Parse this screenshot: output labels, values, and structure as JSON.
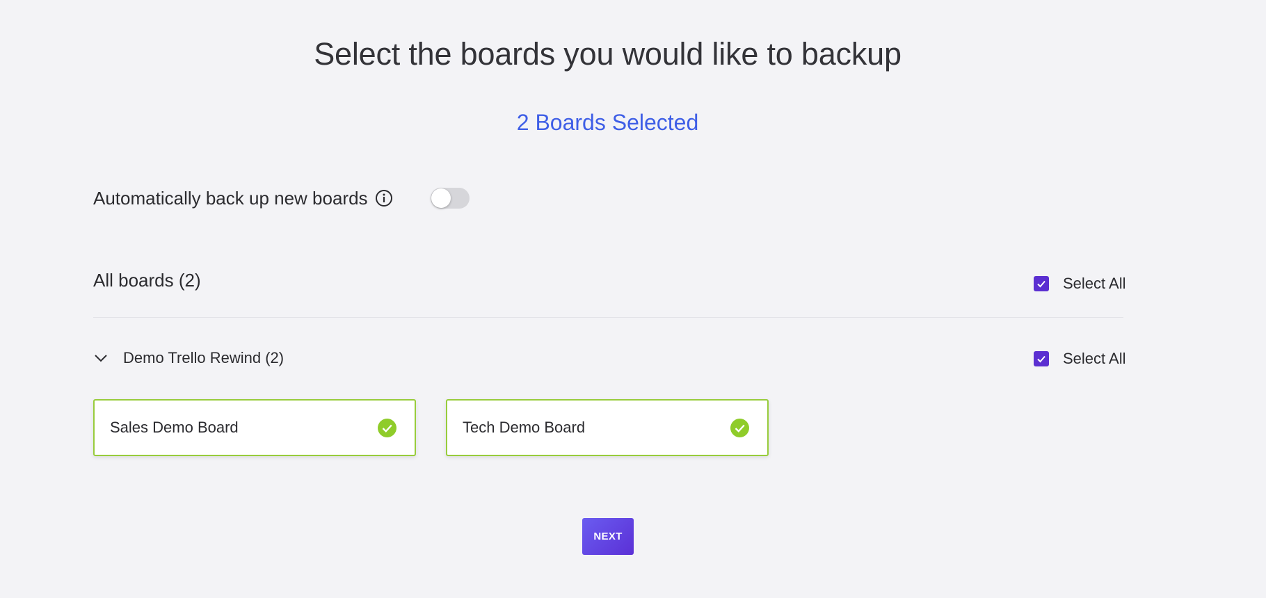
{
  "header": {
    "title": "Select the boards you would like to backup",
    "selected_count": "2 Boards Selected"
  },
  "auto_backup": {
    "label": "Automatically back up new boards",
    "info_icon": "info-circle-icon",
    "enabled": false
  },
  "boards_section": {
    "title": "All boards (2)",
    "select_all_label": "Select All",
    "select_all_checked": true
  },
  "workspace_group": {
    "name": "Demo Trello Rewind (2)",
    "expanded": true,
    "select_all_label": "Select All",
    "select_all_checked": true,
    "boards": [
      {
        "name": "Sales Demo Board",
        "selected": true
      },
      {
        "name": "Tech Demo Board",
        "selected": true
      }
    ]
  },
  "footer": {
    "next_label": "NEXT"
  },
  "colors": {
    "accent_blue": "#3e5ee6",
    "checkbox_purple": "#5b2fd1",
    "selected_green": "#98cc3c",
    "check_green": "#8fcc2a",
    "background": "#f3f3f6"
  }
}
